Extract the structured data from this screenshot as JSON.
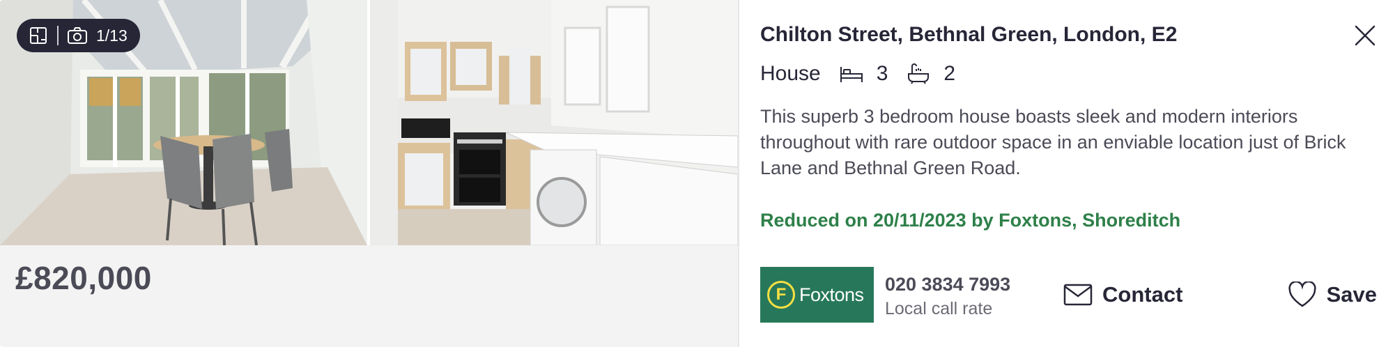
{
  "gallery": {
    "counter": "1/13",
    "icons": [
      "floorplan-icon",
      "camera-icon"
    ],
    "photos": [
      {
        "label": "conservatory-dining-photo"
      },
      {
        "label": "kitchen-photo"
      }
    ]
  },
  "listing": {
    "price": "£820,000",
    "address": "Chilton Street, Bethnal Green, London, E2",
    "property_type": "House",
    "bedrooms": "3",
    "bathrooms": "2",
    "description": "This superb 3 bedroom house boasts sleek and modern interiors throughout with rare outdoor space in an enviable location just of Brick Lane and Bethnal Green Road.",
    "reduced_text": "Reduced on 20/11/2023 by Foxtons, Shoreditch"
  },
  "agent": {
    "logo_letter": "F",
    "logo_name": "Foxtons",
    "brand_color": "#27785a",
    "phone": "020 3834 7993",
    "call_rate": "Local call rate"
  },
  "actions": {
    "contact_label": "Contact",
    "save_label": "Save"
  },
  "colors": {
    "text_primary": "#262637",
    "reduced_green": "#2e8049",
    "badge_bg": "#262637"
  }
}
